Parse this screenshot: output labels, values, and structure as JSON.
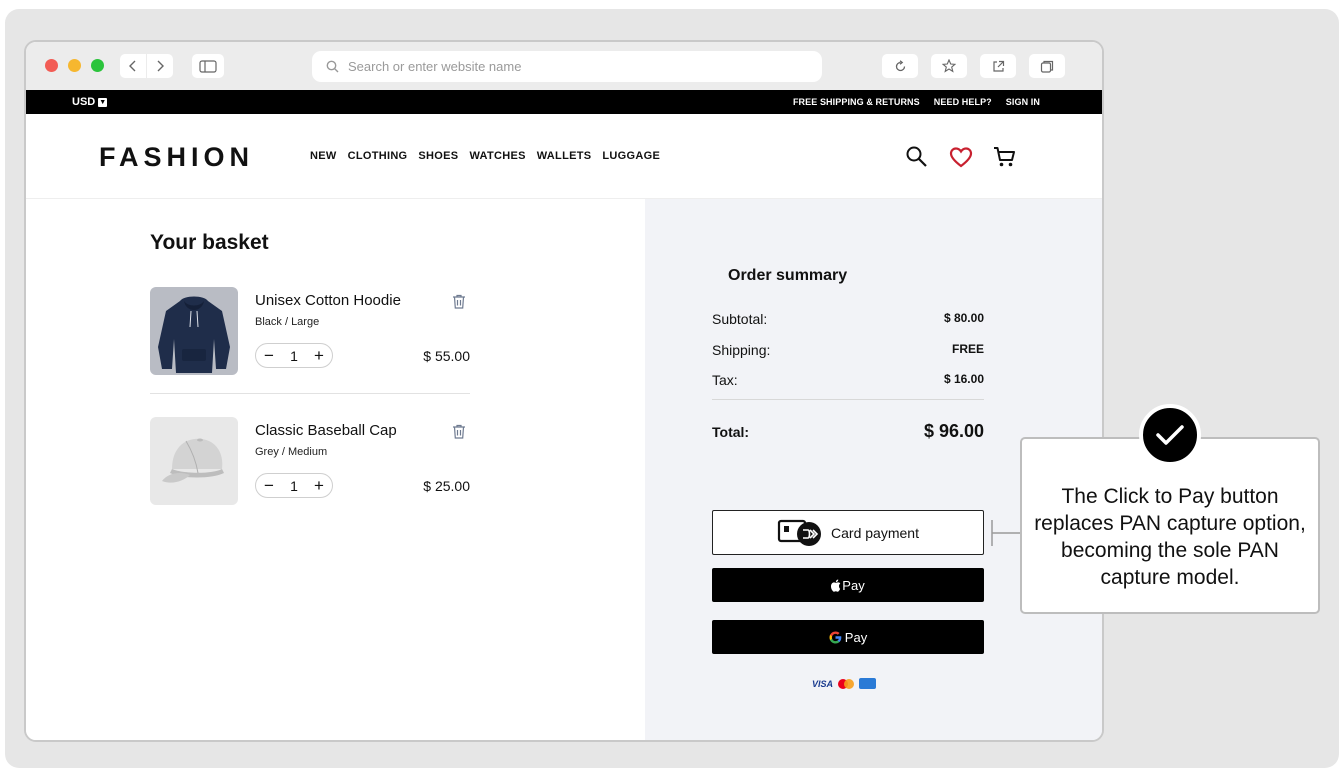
{
  "browser": {
    "address_placeholder": "Search or enter website name"
  },
  "topbar": {
    "currency": "USD",
    "links": [
      "FREE SHIPPING & RETURNS",
      "NEED HELP?",
      "SIGN IN"
    ]
  },
  "header": {
    "logo": "FASHION",
    "nav": [
      "NEW",
      "CLOTHING",
      "SHOES",
      "WATCHES",
      "WALLETS",
      "LUGGAGE"
    ]
  },
  "basket": {
    "title": "Your basket",
    "items": [
      {
        "name": "Unisex Cotton Hoodie",
        "variant": "Black / Large",
        "quantity": "1",
        "price": "$ 55.00"
      },
      {
        "name": "Classic Baseball Cap",
        "variant": "Grey / Medium",
        "quantity": "1",
        "price": "$ 25.00"
      }
    ]
  },
  "summary": {
    "title": "Order summary",
    "subtotal_label": "Subtotal:",
    "subtotal": "$ 80.00",
    "shipping_label": "Shipping:",
    "shipping": "FREE",
    "tax_label": "Tax:",
    "tax": "$ 16.00",
    "total_label": "Total:",
    "total": "$ 96.00",
    "card_button": "Card payment",
    "apple_pay": "Pay",
    "google_pay": "Pay",
    "visa": "VISA"
  },
  "callout": {
    "text": "The Click to Pay button replaces PAN capture option, becoming the sole PAN capture model."
  },
  "colors": {
    "accent_heart": "#c8202f",
    "promo_bar": "#000000",
    "summary_bg": "#f2f3f7"
  },
  "icons": [
    "back-icon",
    "forward-icon",
    "sidebar-icon",
    "search-icon",
    "reload-icon",
    "star-icon",
    "share-icon",
    "tabs-icon",
    "heart-icon",
    "cart-icon",
    "trash-icon",
    "card-icon",
    "apple-icon",
    "google-icon",
    "check-icon"
  ]
}
